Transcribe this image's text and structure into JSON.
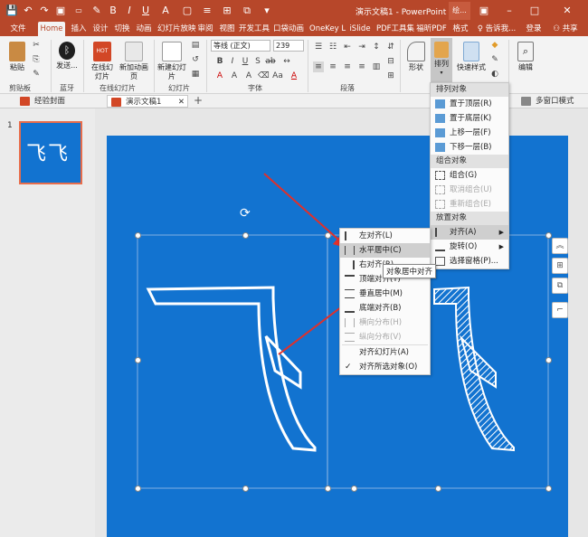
{
  "window": {
    "title": "演示文稿1 - PowerPoint",
    "title_suffix": "绘...",
    "login": "登录",
    "share": "共享"
  },
  "quick_access": {
    "save": "💾",
    "undo": "↶",
    "redo": "↷",
    "start": "▣"
  },
  "tabs": [
    "文件",
    "Home",
    "插入",
    "设计",
    "切换",
    "动画",
    "幻灯片放映",
    "审阅",
    "视图",
    "开发工具",
    "口袋动画",
    "OneKey L",
    "iSlide",
    "PDF工具集",
    "福昕PDF",
    "格式"
  ],
  "tell_me": "告诉我...",
  "ribbon": {
    "paste": "粘贴",
    "clipboard_group": "剪贴板",
    "bluetooth_btn": "发送...",
    "bluetooth_group": "蓝牙",
    "online_btn": "在线幻灯片",
    "new_anim_btn": "新加动画页",
    "online_group": "在线幻灯片",
    "new_slide_btn": "新建幻灯片",
    "slides_group": "幻灯片",
    "font_name": "等线 (正文)",
    "font_size": "239",
    "font_group": "字体",
    "paragraph_group": "段落",
    "shapes_btn": "形状",
    "arrange_btn": "排列",
    "quick_styles_btn": "快速样式",
    "edit_btn": "编辑"
  },
  "doc_tabs": {
    "tab1": "经验封面",
    "tab2": "演示文稿1",
    "add": "+",
    "multi_window": "多窗口模式"
  },
  "thumbnail": {
    "number": "1",
    "text": "飞飞"
  },
  "slide": {
    "char1": "飞",
    "char2": "飞"
  },
  "arrange_menu": {
    "section1": "排列对象",
    "bring_front": "置于顶层(R)",
    "send_back": "置于底层(K)",
    "forward": "上移一层(F)",
    "backward": "下移一层(B)",
    "section2": "组合对象",
    "group": "组合(G)",
    "ungroup": "取消组合(U)",
    "regroup": "重新组合(E)",
    "section3": "放置对象",
    "align": "对齐(A)",
    "rotate": "旋转(O)",
    "selection_pane": "选择窗格(P)..."
  },
  "align_menu": {
    "left": "左对齐(L)",
    "center": "水平居中(C)",
    "right": "右对齐(R)",
    "top": "顶端对齐(T)",
    "middle": "垂直居中(M)",
    "bottom": "底端对齐(B)",
    "dist_h": "横向分布(H)",
    "dist_v": "纵向分布(V)",
    "to_slide": "对齐幻灯片(A)",
    "to_selected": "对齐所选对象(O)",
    "check": "✓"
  },
  "tooltip": "对象居中对齐",
  "colors": {
    "accent": "#b7472a",
    "slide_bg": "#1273d0",
    "menu_highlight": "#cfcfcf",
    "arrow": "#e0302a"
  }
}
